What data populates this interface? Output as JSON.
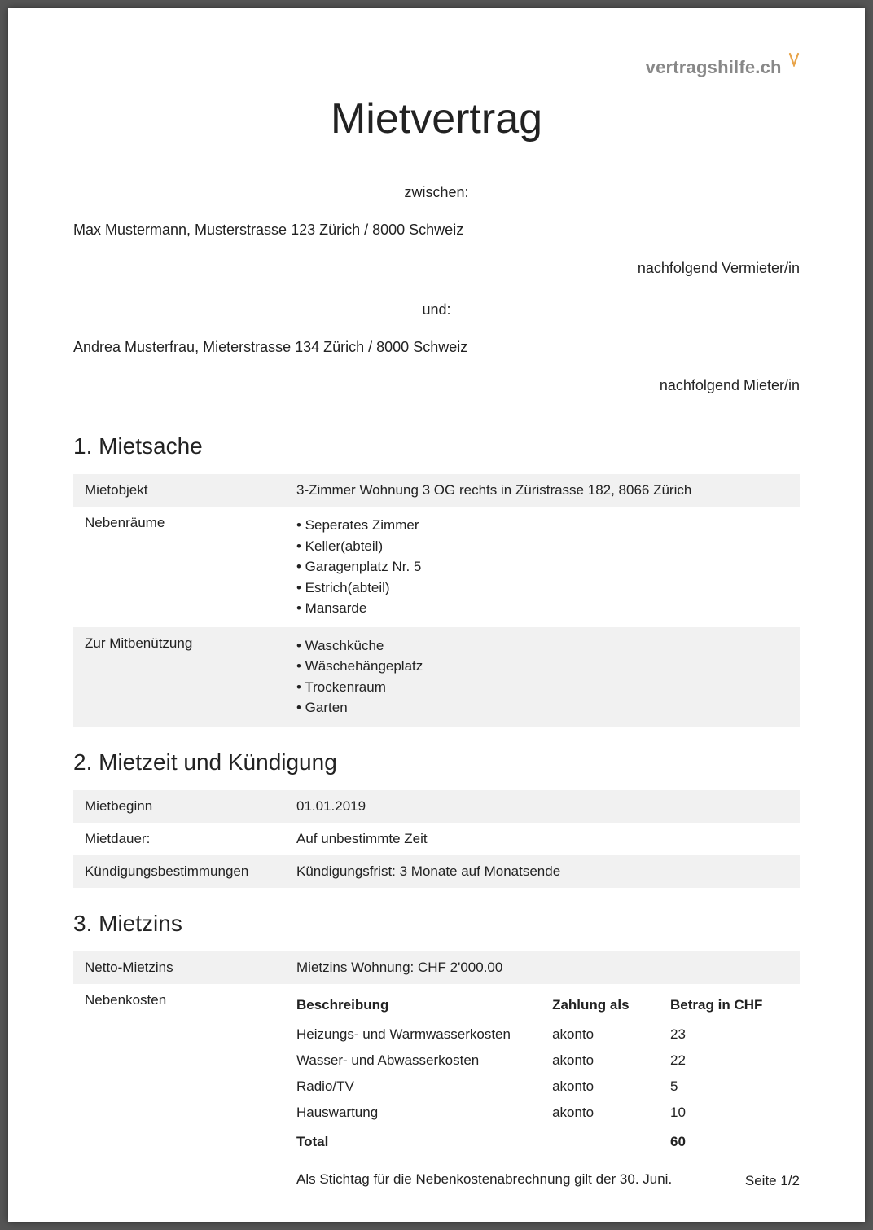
{
  "brand": {
    "name": "vertragshilfe.ch"
  },
  "title": "Mietvertrag",
  "intro": {
    "between": "zwischen:",
    "landlord_line": "Max Mustermann, Musterstrasse 123 Zürich / 8000 Schweiz",
    "landlord_role": "nachfolgend Vermieter/in",
    "and": "und:",
    "tenant_line": "Andrea Musterfrau, Mieterstrasse 134 Zürich / 8000 Schweiz",
    "tenant_role": "nachfolgend Mieter/in"
  },
  "sections": {
    "s1": {
      "heading": "1. Mietsache",
      "rows": {
        "object_label": "Mietobjekt",
        "object_value": "3-Zimmer Wohnung 3 OG rechts in Züristrasse 182, 8066 Zürich",
        "side_label": "Nebenräume",
        "side_items": [
          "• Seperates Zimmer",
          "• Keller(abteil)",
          "• Garagenplatz Nr. 5",
          "• Estrich(abteil)",
          "• Mansarde"
        ],
        "shared_label": "Zur Mitbenützung",
        "shared_items": [
          "• Waschküche",
          "• Wäschehängeplatz",
          "• Trockenraum",
          "• Garten"
        ]
      }
    },
    "s2": {
      "heading": "2. Mietzeit und Kündigung",
      "rows": {
        "start_label": "Mietbeginn",
        "start_value": "01.01.2019",
        "duration_label": "Mietdauer:",
        "duration_value": "Auf unbestimmte Zeit",
        "termination_label": "Kündigungsbestimmungen",
        "termination_value": "Kündigungsfrist: 3 Monate auf Monatsende"
      }
    },
    "s3": {
      "heading": "3. Mietzins",
      "rows": {
        "net_label": "Netto-Mietzins",
        "net_value": "Mietzins Wohnung: CHF 2'000.00",
        "extra_label": "Nebenkosten",
        "table_headers": {
          "desc": "Beschreibung",
          "pay": "Zahlung als",
          "amt": "Betrag in CHF"
        },
        "items": [
          {
            "desc": "Heizungs- und Warmwasserkosten",
            "pay": "akonto",
            "amt": "23"
          },
          {
            "desc": "Wasser- und Abwasserkosten",
            "pay": "akonto",
            "amt": "22"
          },
          {
            "desc": "Radio/TV",
            "pay": "akonto",
            "amt": "5"
          },
          {
            "desc": "Hauswartung",
            "pay": "akonto",
            "amt": "10"
          }
        ],
        "total_label": "Total",
        "total_value": "60",
        "note": "Als Stichtag für die Nebenkostenabrechnung gilt der 30. Juni."
      }
    }
  },
  "footer": {
    "page_label": "Seite 1/2"
  }
}
